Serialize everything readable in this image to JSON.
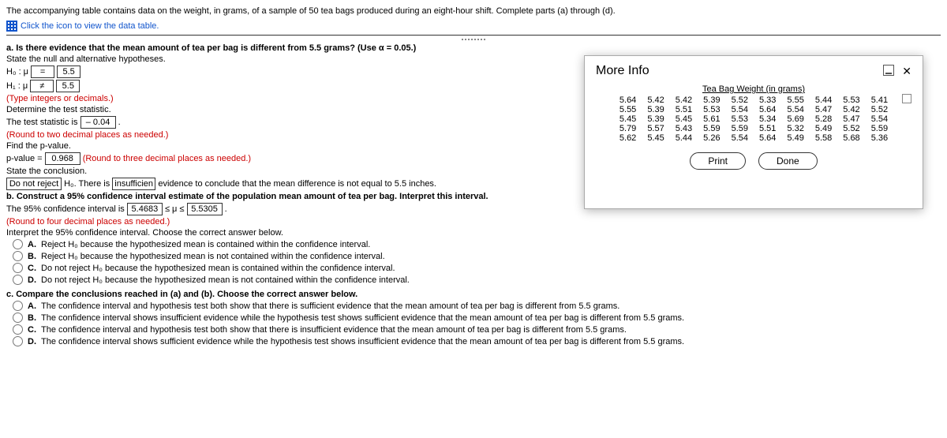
{
  "intro": {
    "prompt": "The accompanying table contains data on the weight, in grams, of a sample of 50 tea bags produced during an eight-hour shift. Complete parts (a) through (d).",
    "link_text": "Click the icon to view the data table."
  },
  "partA": {
    "question": "a. Is there evidence that the mean amount of tea per bag is different from 5.5 grams? (Use α = 0.05.)",
    "state_hyp": "State the null and alternative hypotheses.",
    "h0_prefix": "H₀ : μ",
    "h0_op": "=",
    "h0_val": "5.5",
    "h1_prefix": "H₁ : μ",
    "h1_op": "≠",
    "h1_val": "5.5",
    "type_hint": "(Type integers or decimals.)",
    "det_stat": "Determine the test statistic.",
    "stat_pre": "The test statistic is",
    "stat_val": "– 0.04",
    "stat_post": ".",
    "stat_round": "(Round to two decimal places as needed.)",
    "find_p": "Find the p-value.",
    "p_pre": "p-value =",
    "p_val": "0.968",
    "p_round": "(Round to three decimal places as needed.)",
    "state_conc": "State the conclusion.",
    "conc_box1": "Do not reject",
    "conc_mid1": " H₀. There is ",
    "conc_box2": "insufficient",
    "conc_tail": " evidence to conclude that the mean difference is not equal to 5.5 inches."
  },
  "partB": {
    "question": "b. Construct a 95% confidence interval estimate of the population mean amount of tea per bag. Interpret this interval.",
    "ci_pre": "The 95% confidence interval is",
    "ci_lo": "5.4683",
    "ci_mid": "≤ μ ≤",
    "ci_hi": "5.5305",
    "ci_post": ".",
    "ci_round": "(Round to four decimal places as needed.)",
    "interp_q": "Interpret the 95% confidence interval. Choose the correct answer below.",
    "opts": {
      "A": "Reject H₀ because the hypothesized mean is contained within the confidence interval.",
      "B": "Reject H₀ because the hypothesized mean is not contained within the confidence interval.",
      "C": "Do not reject H₀ because the hypothesized mean is contained within the confidence interval.",
      "D": "Do not reject H₀ because the hypothesized mean is not contained within the confidence interval."
    }
  },
  "partC": {
    "question": "c. Compare the conclusions reached in (a) and (b). Choose the correct answer below.",
    "opts": {
      "A": "The confidence interval and hypothesis test both show that there is sufficient evidence that the mean amount of tea per bag is different from 5.5 grams.",
      "B": "The confidence interval shows insufficient evidence while the hypothesis test shows sufficient evidence that the mean amount of tea per bag is different from 5.5 grams.",
      "C": "The confidence interval and hypothesis test both show that there is insufficient evidence that the mean amount of tea per bag is different from 5.5 grams.",
      "D": "The confidence interval shows sufficient evidence while the hypothesis test shows insufficient evidence that the mean amount of tea per bag is different from 5.5 grams."
    }
  },
  "modal": {
    "title": "More Info",
    "header": "Tea Bag Weight (in grams)",
    "rows": [
      [
        "5.64",
        "5.42",
        "5.42",
        "5.39",
        "5.52",
        "5.33",
        "5.55",
        "5.44",
        "5.53",
        "5.41"
      ],
      [
        "5.55",
        "5.39",
        "5.51",
        "5.53",
        "5.54",
        "5.64",
        "5.54",
        "5.47",
        "5.42",
        "5.52"
      ],
      [
        "5.45",
        "5.39",
        "5.45",
        "5.61",
        "5.53",
        "5.34",
        "5.69",
        "5.28",
        "5.47",
        "5.54"
      ],
      [
        "5.79",
        "5.57",
        "5.43",
        "5.59",
        "5.59",
        "5.51",
        "5.32",
        "5.49",
        "5.52",
        "5.59"
      ],
      [
        "5.62",
        "5.45",
        "5.44",
        "5.26",
        "5.54",
        "5.64",
        "5.49",
        "5.58",
        "5.68",
        "5.36"
      ]
    ],
    "print": "Print",
    "done": "Done"
  }
}
